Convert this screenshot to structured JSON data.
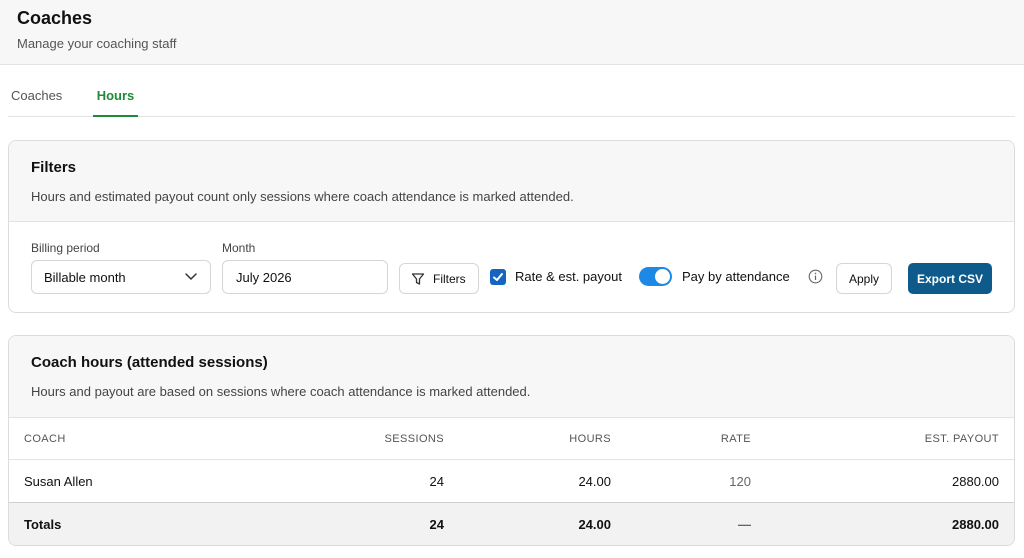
{
  "header": {
    "title": "Coaches",
    "subtitle": "Manage your coaching staff"
  },
  "tabs": [
    {
      "label": "Coaches",
      "active": false
    },
    {
      "label": "Hours",
      "active": true
    }
  ],
  "filters": {
    "title": "Filters",
    "description": "Hours and estimated payout count only sessions where coach attendance is marked attended.",
    "billing_period": {
      "label": "Billing period",
      "value": "Billable month"
    },
    "month": {
      "label": "Month",
      "value": "July 2026"
    },
    "filters_button": "Filters",
    "rate_checkbox": {
      "label": "Rate & est. payout",
      "checked": true
    },
    "attendance_toggle": {
      "label": "Pay by attendance",
      "on": true
    },
    "apply_button": "Apply",
    "export_button": "Export CSV"
  },
  "hours_table": {
    "title": "Coach hours (attended sessions)",
    "description": "Hours and payout are based on sessions where coach attendance is marked attended.",
    "columns": [
      "COACH",
      "SESSIONS",
      "HOURS",
      "RATE",
      "EST. PAYOUT"
    ],
    "rows": [
      {
        "coach": "Susan Allen",
        "sessions": "24",
        "hours": "24.00",
        "rate": "120",
        "payout": "2880.00"
      }
    ],
    "totals": {
      "label": "Totals",
      "sessions": "24",
      "hours": "24.00",
      "rate": "—",
      "payout": "2880.00"
    }
  },
  "colors": {
    "accent_green": "#1f8a3a",
    "primary_blue": "#0e5a8a",
    "toggle_blue": "#1e88e5"
  }
}
